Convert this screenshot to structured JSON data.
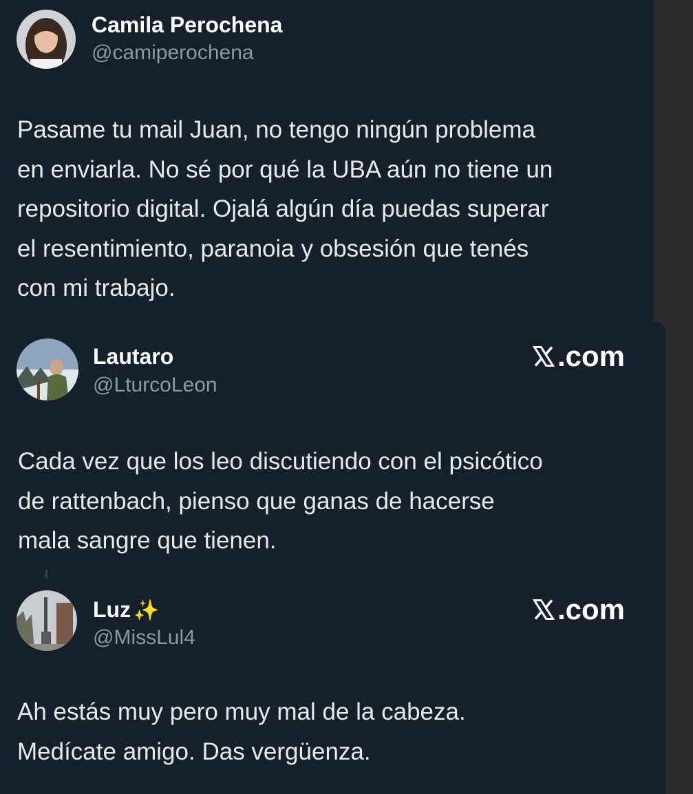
{
  "tweets": [
    {
      "name": "Camila Perochena",
      "handle": "@camiperochena",
      "text": "Pasame tu mail Juan, no tengo ningún problema\nen enviarla. No sé por qué la UBA aún no tiene un\nrepositorio digital. Ojalá algún día puedas superar\nel resentimiento, paranoia y obsesión que tenés\ncon mi trabajo."
    },
    {
      "name": "Lautaro",
      "handle": "@LturcoLeon",
      "source": ".com",
      "text": "Cada vez que los leo discutiendo con el psicótico\nde rattenbach, pienso que ganas de hacerse\nmala sangre que tienen."
    },
    {
      "name": "Luz",
      "name_emoji": "✨",
      "handle": "@MissLul4",
      "source": ".com",
      "text": "Ah estás muy pero muy mal de la cabeza.\nMedícate amigo. Das vergüenza."
    }
  ],
  "colors": {
    "card_bg": "#15202b",
    "text": "#e7e9ea",
    "muted": "#8b98a5"
  }
}
